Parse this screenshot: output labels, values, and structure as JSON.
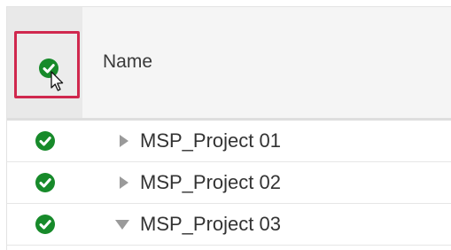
{
  "header": {
    "name_label": "Name",
    "select_all_icon": "check-circle-icon",
    "cursor_icon": "pointer-cursor-icon",
    "highlight_color": "#d0284e"
  },
  "rows": [
    {
      "label": "MSP_Project 01",
      "selected": true,
      "expanded": false
    },
    {
      "label": "MSP_Project 02",
      "selected": true,
      "expanded": false
    },
    {
      "label": "MSP_Project 03",
      "selected": true,
      "expanded": true
    }
  ],
  "colors": {
    "check": "#178a2a",
    "header_bg": "#f5f5f5",
    "select_cell_bg": "#e9e9e9",
    "expander": "#9a9a9a"
  }
}
